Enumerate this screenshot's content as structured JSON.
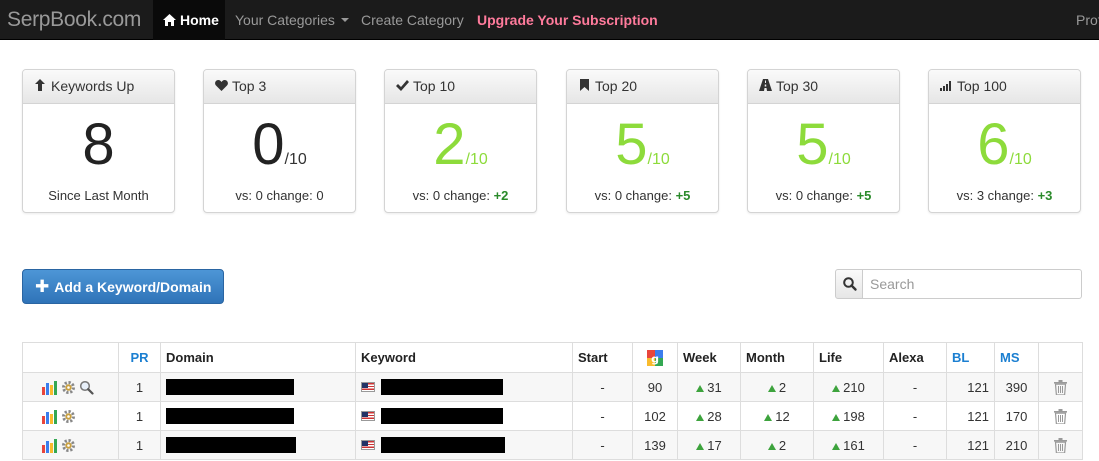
{
  "nav": {
    "brand": "SerpBook.com",
    "home": "Home",
    "categories": "Your Categories",
    "create": "Create Category",
    "upgrade": "Upgrade Your Subscription",
    "profile": "Prof"
  },
  "cards": [
    {
      "title": "Keywords Up",
      "icon": "arrow-up-icon",
      "value": "8",
      "denom": "",
      "foot": "Since Last Month",
      "change": ""
    },
    {
      "title": "Top 3",
      "icon": "heart-icon",
      "value": "0",
      "denom": "/10",
      "foot": "vs: 0 change: 0",
      "change": ""
    },
    {
      "title": "Top 10",
      "icon": "checkmark-icon",
      "value": "2",
      "denom": "/10",
      "foot": "vs: 0 change: ",
      "change": "+2"
    },
    {
      "title": "Top 20",
      "icon": "bookmark-icon",
      "value": "5",
      "denom": "/10",
      "foot": "vs: 0 change: ",
      "change": "+5"
    },
    {
      "title": "Top 30",
      "icon": "road-icon",
      "value": "5",
      "denom": "/10",
      "foot": "vs: 0 change: ",
      "change": "+5"
    },
    {
      "title": "Top 100",
      "icon": "signal-icon",
      "value": "6",
      "denom": "/10",
      "foot": "vs: 3 change: ",
      "change": "+3"
    }
  ],
  "add_button": "Add a Keyword/Domain",
  "search": {
    "placeholder": "Search"
  },
  "table": {
    "headers": {
      "pr": "PR",
      "domain": "Domain",
      "keyword": "Keyword",
      "start": "Start",
      "week": "Week",
      "month": "Month",
      "life": "Life",
      "alexa": "Alexa",
      "bl": "BL",
      "ms": "MS"
    },
    "rows": [
      {
        "pr": "1",
        "start": "-",
        "google": "90",
        "week": "31",
        "month": "2",
        "life": "210",
        "alexa": "-",
        "bl": "121",
        "ms": "390"
      },
      {
        "pr": "1",
        "start": "-",
        "google": "102",
        "week": "28",
        "month": "12",
        "life": "198",
        "alexa": "-",
        "bl": "121",
        "ms": "170"
      },
      {
        "pr": "1",
        "start": "-",
        "google": "139",
        "week": "17",
        "month": "2",
        "life": "161",
        "alexa": "-",
        "bl": "121",
        "ms": "210"
      }
    ]
  },
  "colors": {
    "accent_green": "#8ddb3b",
    "change_green": "#2a8a2a",
    "upgrade_pink": "#ff7b9c",
    "link_blue": "#1b7fd1",
    "button_blue": "#2f73b8"
  }
}
